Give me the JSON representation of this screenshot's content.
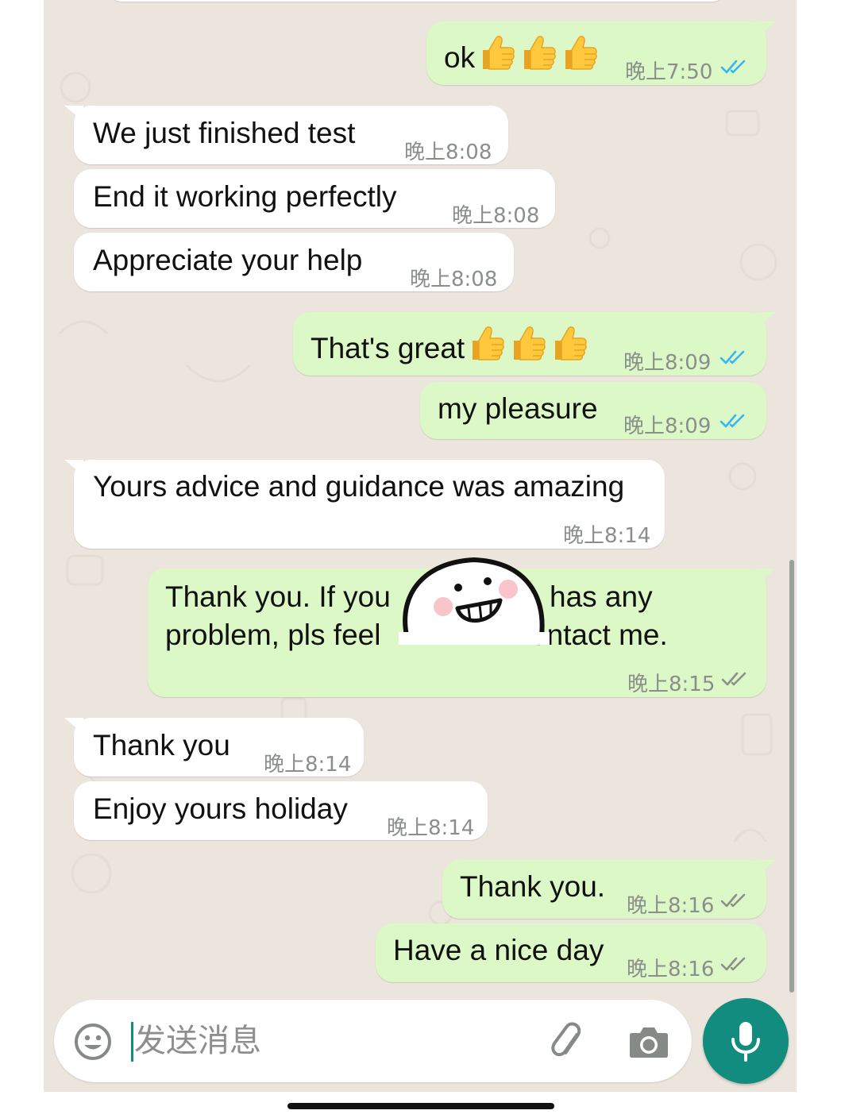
{
  "colors": {
    "incoming_bubble": "#ffffff",
    "outgoing_bubble": "#dcf8c6",
    "read_ticks": "#34b7f1",
    "delivered_ticks": "#8a8f8c",
    "chat_background": "#ece5dd",
    "accent": "#128c7e"
  },
  "messages": [
    {
      "direction": "out",
      "text": "ok",
      "emoji": "thumbs-up x3",
      "time": "晚上7:50",
      "status": "read"
    },
    {
      "direction": "in",
      "text": "We just finished test",
      "time": "晚上8:08"
    },
    {
      "direction": "in",
      "text": "End it working perfectly",
      "time": "晚上8:08"
    },
    {
      "direction": "in",
      "text": "Appreciate your help",
      "time": "晚上8:08"
    },
    {
      "direction": "out",
      "text": "That's great",
      "emoji": "thumbs-up x3",
      "time": "晚上8:09",
      "status": "read"
    },
    {
      "direction": "out",
      "text": "my pleasure",
      "time": "晚上8:09",
      "status": "read"
    },
    {
      "direction": "in",
      "text": "Yours advice and guidance was amazing",
      "time": "晚上8:14"
    },
    {
      "direction": "out",
      "line1_left": "Thank you. If you",
      "line1_right": "has any",
      "line2_left": "problem, pls feel",
      "line2_right": "ontact me.",
      "time": "晚上8:15",
      "status": "delivered"
    },
    {
      "direction": "in",
      "text": "Thank you",
      "time": "晚上8:14"
    },
    {
      "direction": "in",
      "text": "Enjoy yours holiday",
      "time": "晚上8:14"
    },
    {
      "direction": "out",
      "text": "Thank you.",
      "time": "晚上8:16",
      "status": "delivered"
    },
    {
      "direction": "out",
      "text": "Have a nice day",
      "time": "晚上8:16",
      "status": "delivered"
    }
  ],
  "composer": {
    "placeholder": "发送消息",
    "emoji_icon": "smiley-icon",
    "attach_icon": "paperclip-icon",
    "camera_icon": "camera-icon",
    "send_icon": "microphone-icon"
  }
}
